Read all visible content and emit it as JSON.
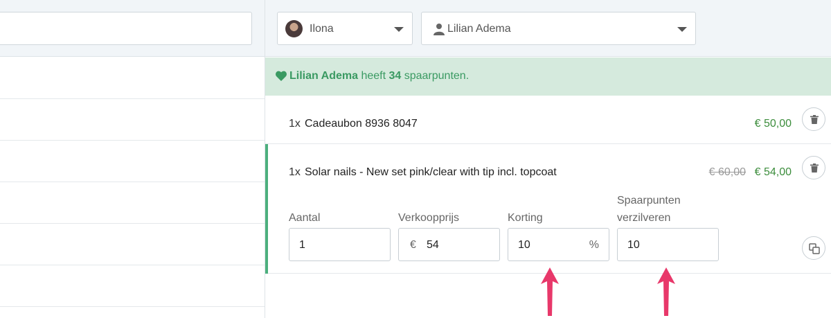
{
  "header": {
    "employee_select": {
      "value": "Ilona",
      "avatar": "employee-avatar"
    },
    "customer_select": {
      "value": "Lilian Adema",
      "icon": "user-icon"
    }
  },
  "loyalty": {
    "customer_name": "Lilian Adema",
    "middle_text": "heeft",
    "points": "34",
    "suffix_text": "spaarpunten.",
    "color": "#3a9a62"
  },
  "line_items": [
    {
      "qty": "1x",
      "name": "Cadeaubon 8936 8047",
      "price": "€ 50,00"
    },
    {
      "qty": "1x",
      "name": "Solar nails - New set pink/clear with tip incl. topcoat",
      "old_price": "€ 60,00",
      "price": "€ 54,00",
      "fields": {
        "aantal": {
          "label": "Aantal",
          "value": "1"
        },
        "verkoopprijs": {
          "label": "Verkoopprijs",
          "prefix": "€",
          "value": "54"
        },
        "korting": {
          "label": "Korting",
          "value": "10",
          "suffix": "%"
        },
        "spaarpunten": {
          "label_line1": "Spaarpunten",
          "label_line2": "verzilveren",
          "value": "10"
        }
      }
    }
  ],
  "colors": {
    "accent_green": "#4caf7d",
    "price_green": "#3c8d3c",
    "annotation_arrow": "#e8386a"
  }
}
